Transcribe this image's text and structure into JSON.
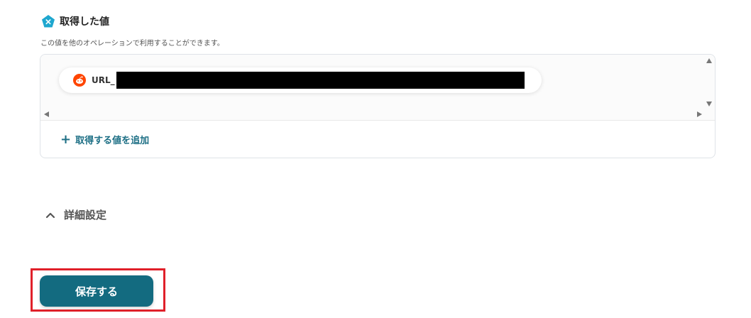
{
  "section": {
    "title": "取得した値",
    "description": "この値を他のオペレーションで利用することができます。",
    "icon": "pentagon-x-icon",
    "icon_color": "#1ea7cf"
  },
  "values": {
    "items": [
      {
        "icon": "reddit-icon",
        "label": "URL_",
        "value_redacted": true
      }
    ],
    "add_label": "取得する値を追加"
  },
  "advanced": {
    "label": "詳細設定",
    "expanded": true
  },
  "save_button": {
    "label": "保存する",
    "color": "#136b80"
  },
  "highlight_color": "#e0202a"
}
